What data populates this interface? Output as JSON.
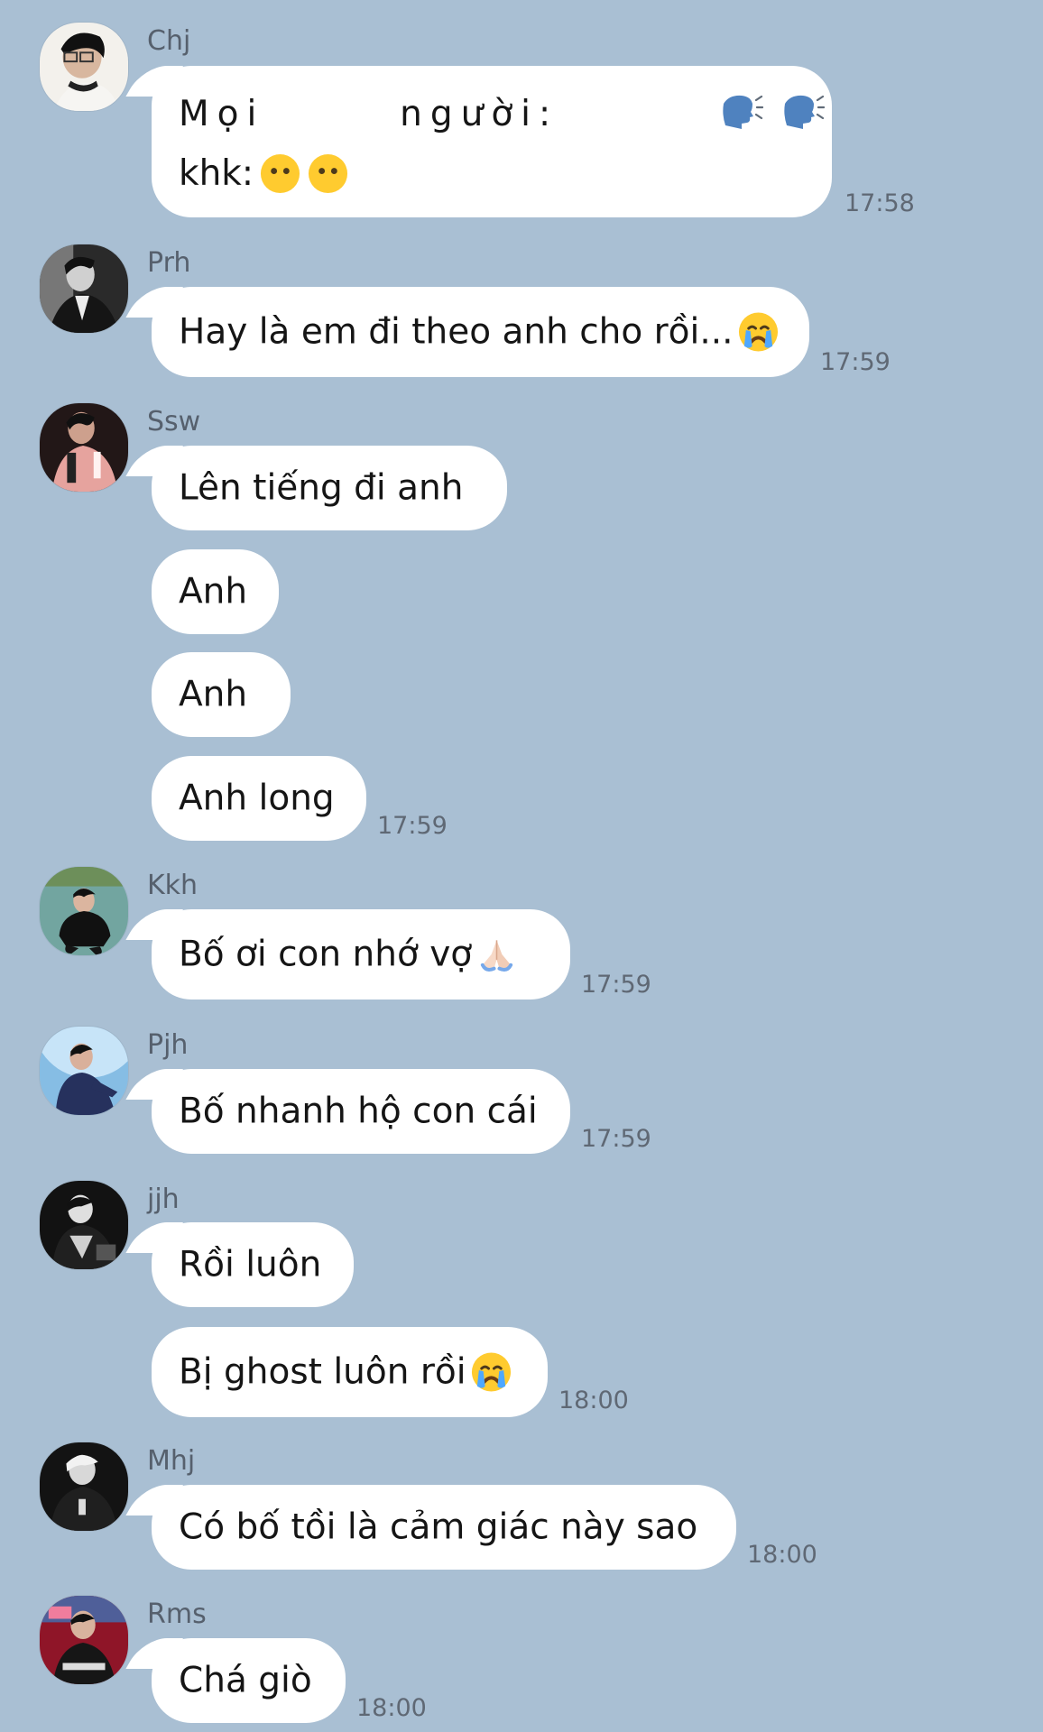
{
  "colors": {
    "background": "#a9bfd3",
    "bubble": "#ffffff",
    "sender_text": "#56606d",
    "time_text": "#5f6874",
    "message_text": "#151515"
  },
  "messages": [
    {
      "sender": "Chj",
      "avatar": "avatar-chj",
      "line1_text": "Mọi       người:",
      "line1_icons": [
        "speaking-head-icon",
        "speaking-head-icon"
      ],
      "line2_text": "khk:",
      "line2_icons": [
        "neutral-face-icon",
        "neutral-face-icon"
      ],
      "time": "17:58"
    },
    {
      "sender": "Prh",
      "avatar": "avatar-prh",
      "text": "Hay là em đi theo anh cho rồi...",
      "icon": "crying-face-icon",
      "time": "17:59"
    },
    {
      "sender": "Ssw",
      "avatar": "avatar-ssw",
      "items": [
        "Lên tiếng đi anh",
        "Anh",
        "Anh",
        "Anh long"
      ],
      "time": "17:59"
    },
    {
      "sender": "Kkh",
      "avatar": "avatar-kkh",
      "text": "Bố ơi con nhớ vợ",
      "icon": "folded-hands-icon",
      "time": "17:59"
    },
    {
      "sender": "Pjh",
      "avatar": "avatar-pjh",
      "text": "Bố nhanh hộ con cái",
      "time": "17:59"
    },
    {
      "sender": "jjh",
      "avatar": "avatar-jjh",
      "items": [
        "Rồi luôn",
        "Bị ghost luôn rồi"
      ],
      "icon": "crying-face-icon",
      "time": "18:00"
    },
    {
      "sender": "Mhj",
      "avatar": "avatar-mhj",
      "text": "Có bố tồi là cảm giác này sao",
      "time": "18:00"
    },
    {
      "sender": "Rms",
      "avatar": "avatar-rms",
      "text": "Chá giò",
      "time": "18:00"
    }
  ]
}
